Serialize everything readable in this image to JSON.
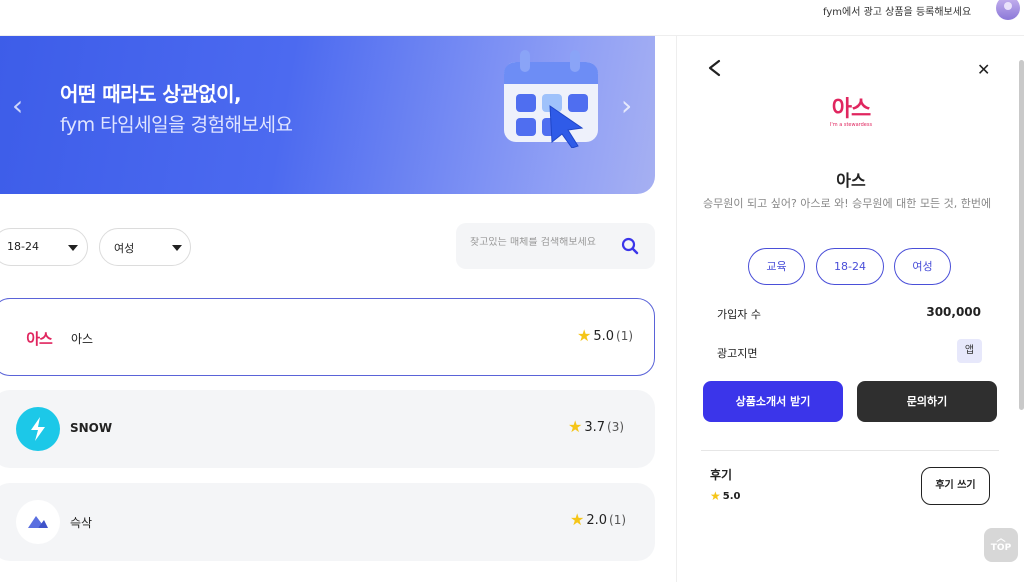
{
  "header": {
    "register_link": "fym에서 광고 상품을 등록해보세요",
    "avatar": "user-avatar"
  },
  "banner": {
    "headline": "어떤 때라도 상관없이,",
    "subline": "fym 타임세일을 경험해보세요",
    "prev_arrow": "‹",
    "next_arrow": "›",
    "illustration": "calendar-cursor-icon"
  },
  "filters": {
    "age": "18-24",
    "gender": "여성"
  },
  "search": {
    "placeholder": "찾고있는 매체를 검색해보세요",
    "icon": "search-icon"
  },
  "media_list": [
    {
      "name": "아스",
      "logo_text": "아스",
      "rating": "5.0",
      "count": "(1)",
      "selected": true
    },
    {
      "name": "SNOW",
      "logo": "snow-bolt-icon",
      "rating": "3.7",
      "count": "(3)",
      "selected": false
    },
    {
      "name": "슥삭",
      "logo": "sukssak-logo",
      "rating": "2.0",
      "count": "(1)",
      "selected": false
    }
  ],
  "panel": {
    "logo_text": "아스",
    "logo_tagline": "I'm a stewardess",
    "title": "아스",
    "description": "승무원이 되고 싶어? 아스로 와! 승무원에 대한 모든 것, 한번에",
    "chips": [
      "교육",
      "18-24",
      "여성"
    ],
    "subscribers_label": "가입자 수",
    "subscribers_value": "300,000",
    "ad_page_label": "광고지면",
    "ad_page_value": "앱",
    "primary_button": "상품소개서 받기",
    "secondary_button": "문의하기",
    "review_title": "후기",
    "review_score": "5.0",
    "review_button": "후기 쓰기"
  },
  "top_button": "TOP",
  "colors": {
    "brand_purple": "#3b35ea",
    "banner_blue": "#4c6af0",
    "ahs_pink": "#e0265f",
    "snow_cyan": "#1cc8e8",
    "star_yellow": "#f5c518"
  }
}
